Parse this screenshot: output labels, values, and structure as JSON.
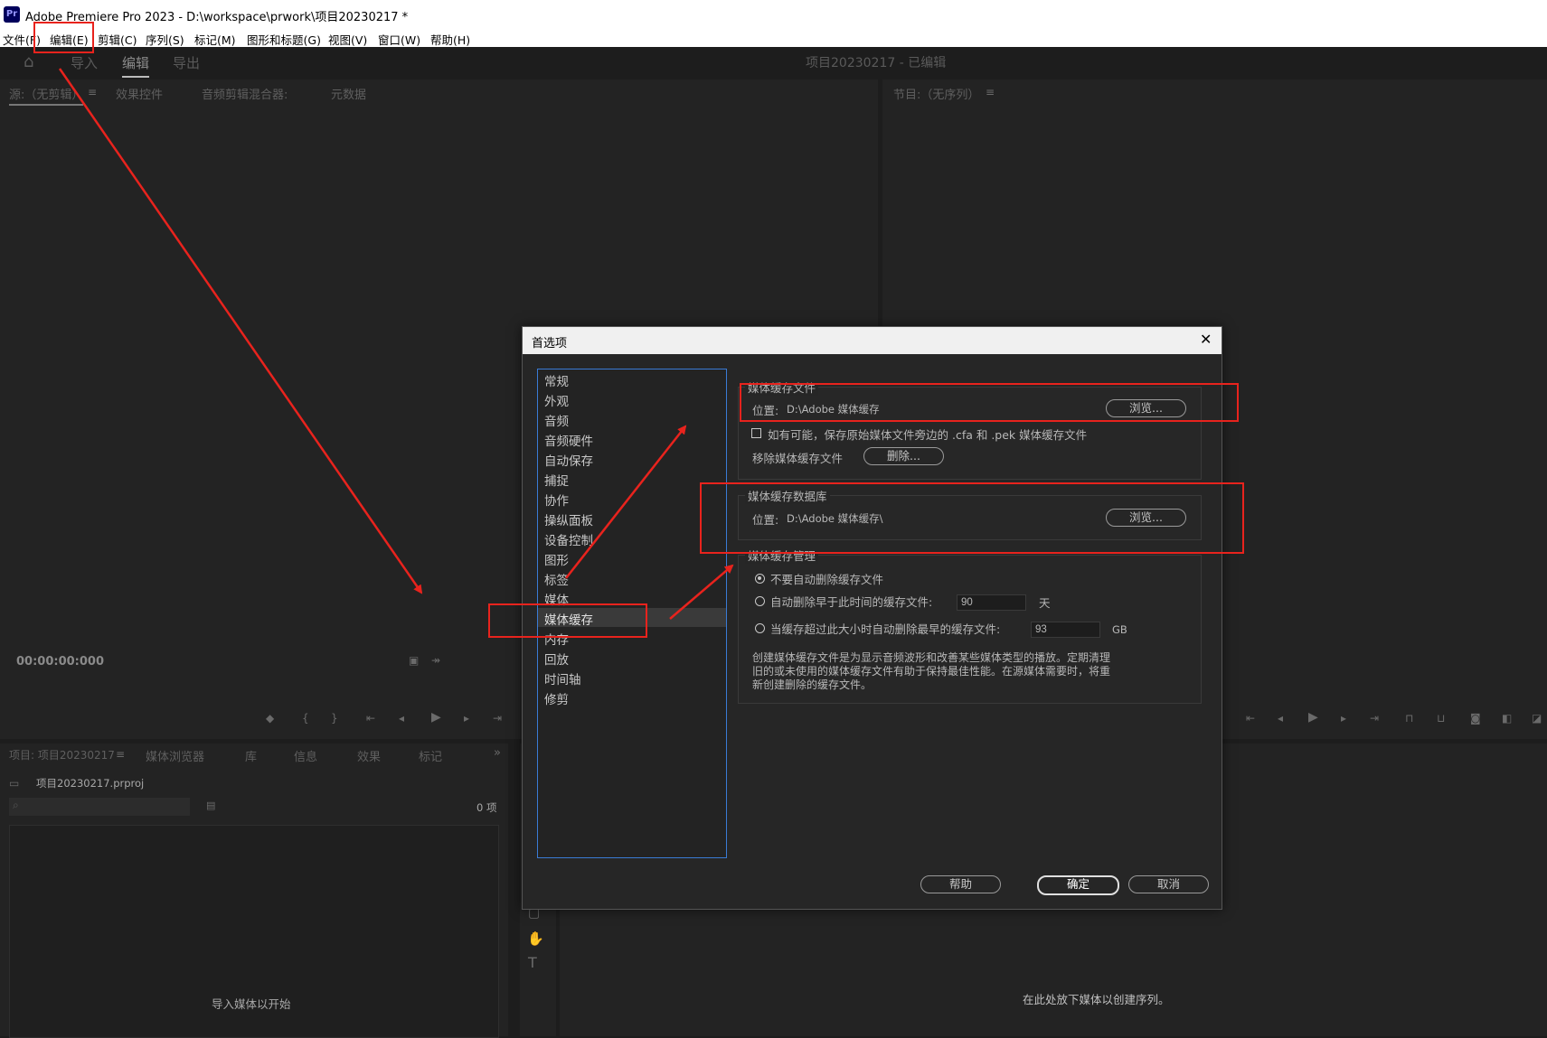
{
  "app": {
    "icon_text": "Pr",
    "title": "Adobe Premiere Pro 2023 - D:\\workspace\\prwork\\项目20230217 *"
  },
  "menu": [
    "文件(F)",
    "编辑(E)",
    "剪辑(C)",
    "序列(S)",
    "标记(M)",
    "图形和标题(G)",
    "视图(V)",
    "窗口(W)",
    "帮助(H)"
  ],
  "workspace": {
    "tabs": [
      "导入",
      "编辑",
      "导出"
    ],
    "active_tab": "编辑",
    "project_title": "项目20230217 - 已编辑"
  },
  "source_panel": {
    "tabs": [
      "源:（无剪辑）",
      "效果控件",
      "音频剪辑混合器:",
      "元数据"
    ],
    "timecode": "00:00:00:000"
  },
  "program_panel": {
    "tab": "节目:（无序列）"
  },
  "project_panel": {
    "tabs": [
      "项目: 项目20230217",
      "媒体浏览器",
      "库",
      "信息",
      "效果",
      "标记"
    ],
    "file_name": "项目20230217.prproj",
    "item_count": "0 项",
    "empty_hint": "导入媒体以开始"
  },
  "timeline_panel": {
    "empty_hint": "在此处放下媒体以创建序列。"
  },
  "dialog": {
    "title": "首选项",
    "categories": [
      "常规",
      "外观",
      "音频",
      "音频硬件",
      "自动保存",
      "捕捉",
      "协作",
      "操纵面板",
      "设备控制",
      "图形",
      "标签",
      "媒体",
      "媒体缓存",
      "内存",
      "回放",
      "时间轴",
      "修剪"
    ],
    "selected_category": "媒体缓存",
    "cache_files": {
      "group_label": "媒体缓存文件",
      "location_label": "位置:",
      "location_value": "D:\\Adobe 媒体缓存",
      "browse_label": "浏览...",
      "save_next_to_original_label": "如有可能，保存原始媒体文件旁边的 .cfa 和 .pek 媒体缓存文件",
      "save_next_to_original_checked": false,
      "remove_label": "移除媒体缓存文件",
      "delete_label": "删除..."
    },
    "cache_database": {
      "group_label": "媒体缓存数据库",
      "location_label": "位置:",
      "location_value": "D:\\Adobe 媒体缓存\\",
      "browse_label": "浏览..."
    },
    "cache_management": {
      "group_label": "媒体缓存管理",
      "option_never": "不要自动删除缓存文件",
      "option_older": "自动删除早于此时间的缓存文件:",
      "older_value": "90",
      "older_unit": "天",
      "option_size": "当缓存超过此大小时自动删除最早的缓存文件:",
      "size_value": "93",
      "size_unit": "GB",
      "selected_option": "option_never",
      "description": "创建媒体缓存文件是为显示音频波形和改善某些媒体类型的播放。定期清理旧的或未使用的媒体缓存文件有助于保持最佳性能。在源媒体需要时，将重新创建删除的缓存文件。"
    },
    "buttons": {
      "help": "帮助",
      "ok": "确定",
      "cancel": "取消"
    }
  },
  "annotation_color": "#e8231d"
}
